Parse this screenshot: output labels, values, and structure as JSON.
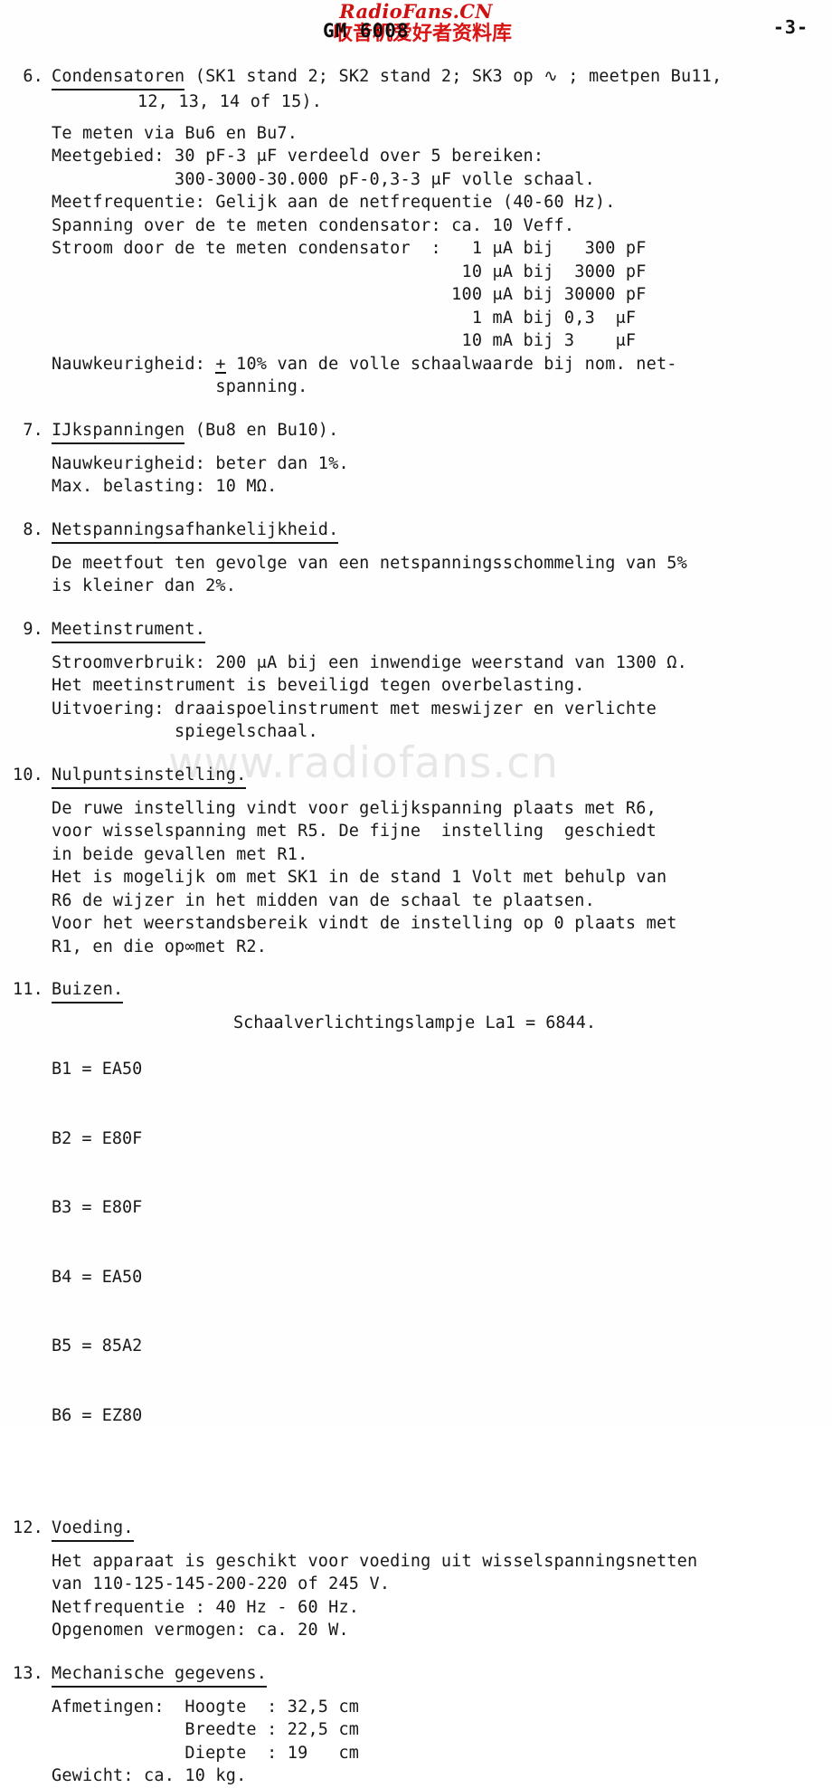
{
  "header": {
    "title": "GM 6008",
    "page_number": "-3-"
  },
  "watermarks": {
    "top_line1": "RadioFans.CN",
    "top_line2": "收音机爱好者资料库",
    "center": "www.radiofans.cn",
    "red_color": "#d81414",
    "gray_color": "#e7e7e7"
  },
  "sections": [
    {
      "number": "6.",
      "title": "Condensatoren",
      "head_rest": " (SK1 stand 2; SK2 stand 2; SK3 op ∿ ; meetpen Bu11,",
      "head_line2": "12, 13, 14 of 15).",
      "lines": [
        "Te meten via Bu6 en Bu7.",
        "Meetgebied: 30 pF-3 μF verdeeld over 5 bereiken:",
        "            300-3000-30.000 pF-0,3-3 μF volle schaal.",
        "Meetfrequentie: Gelijk aan de netfrequentie (40-60 Hz).",
        "Spanning over de te meten condensator: ca. 10 Veff.",
        "Stroom door de te meten condensator  :   1 μA bij   300 pF",
        "                                        10 μA bij  3000 pF",
        "                                       100 μA bij 30000 pF",
        "                                         1 mA bij 0,3  μF",
        "                                        10 mA bij 3    μF"
      ],
      "accuracy_prefix": "Nauwkeurigheid: ",
      "accuracy_pm": "+",
      "accuracy_rest": " 10% van de volle schaalwaarde bij nom. net-",
      "accuracy_line2": "                spanning."
    },
    {
      "number": "7.",
      "title": "IJkspanningen",
      "head_rest": " (Bu8 en Bu10).",
      "lines": [
        "Nauwkeurigheid: beter dan 1%.",
        "Max. belasting: 10 MΩ."
      ]
    },
    {
      "number": "8.",
      "title": "Netspanningsafhankelijkheid.",
      "head_rest": "",
      "lines": [
        "De meetfout ten gevolge van een netspanningsschommeling van 5%",
        "is kleiner dan 2%."
      ]
    },
    {
      "number": "9.",
      "title": "Meetinstrument.",
      "head_rest": "",
      "lines": [
        "Stroomverbruik: 200 μA bij een inwendige weerstand van 1300 Ω.",
        "Het meetinstrument is beveiligd tegen overbelasting.",
        "Uitvoering: draaispoelinstrument met meswijzer en verlichte",
        "            spiegelschaal."
      ]
    },
    {
      "number": "10.",
      "title": "Nulpuntsinstelling.",
      "head_rest": "",
      "lines": [
        "De ruwe instelling vindt voor gelijkspanning plaats met R6,",
        "voor wisselspanning met R5. De fijne  instelling  geschiedt",
        "in beide gevallen met R1.",
        "Het is mogelijk om met SK1 in de stand 1 Volt met behulp van",
        "R6 de wijzer in het midden van de schaal te plaatsen.",
        "Voor het weerstandsbereik vindt de instelling op 0 plaats met",
        "R1, en die op∞met R2."
      ]
    },
    {
      "number": "11.",
      "title": "Buizen.",
      "head_rest": "",
      "tubes": [
        "B1 = EA50",
        "B2 = E80F",
        "B3 = E80F",
        "B4 = EA50",
        "B5 = 85A2",
        "B6 = EZ80"
      ],
      "lamp_note": "Schaalverlichtingslampje La1 = 6844."
    },
    {
      "number": "12.",
      "title": "Voeding.",
      "head_rest": "",
      "lines": [
        "Het apparaat is geschikt voor voeding uit wisselspanningsnetten",
        "van 110-125-145-200-220 of 245 V.",
        "Netfrequentie : 40 Hz - 60 Hz.",
        "Opgenomen vermogen: ca. 20 W."
      ]
    },
    {
      "number": "13.",
      "title": "Mechanische gegevens.",
      "head_rest": "",
      "lines": [
        "Afmetingen:  Hoogte  : 32,5 cm",
        "             Breedte : 22,5 cm",
        "             Diepte  : 19   cm",
        "Gewicht: ca. 10 kg."
      ]
    }
  ]
}
